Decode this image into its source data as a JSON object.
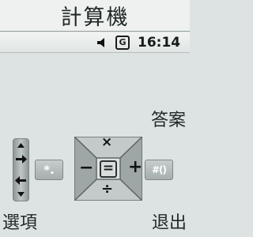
{
  "title": "計算機",
  "status": {
    "sound_icon": "speaker-icon",
    "network_label": "G",
    "time": "16:14"
  },
  "softkeys": {
    "answer": "答案",
    "options": "選項",
    "exit": "退出"
  },
  "keypad": {
    "star_label": "*.",
    "hash_label": "#()",
    "center_label": "=",
    "up_label": "×",
    "down_label": "÷",
    "left_label": "−",
    "right_label": "+"
  }
}
